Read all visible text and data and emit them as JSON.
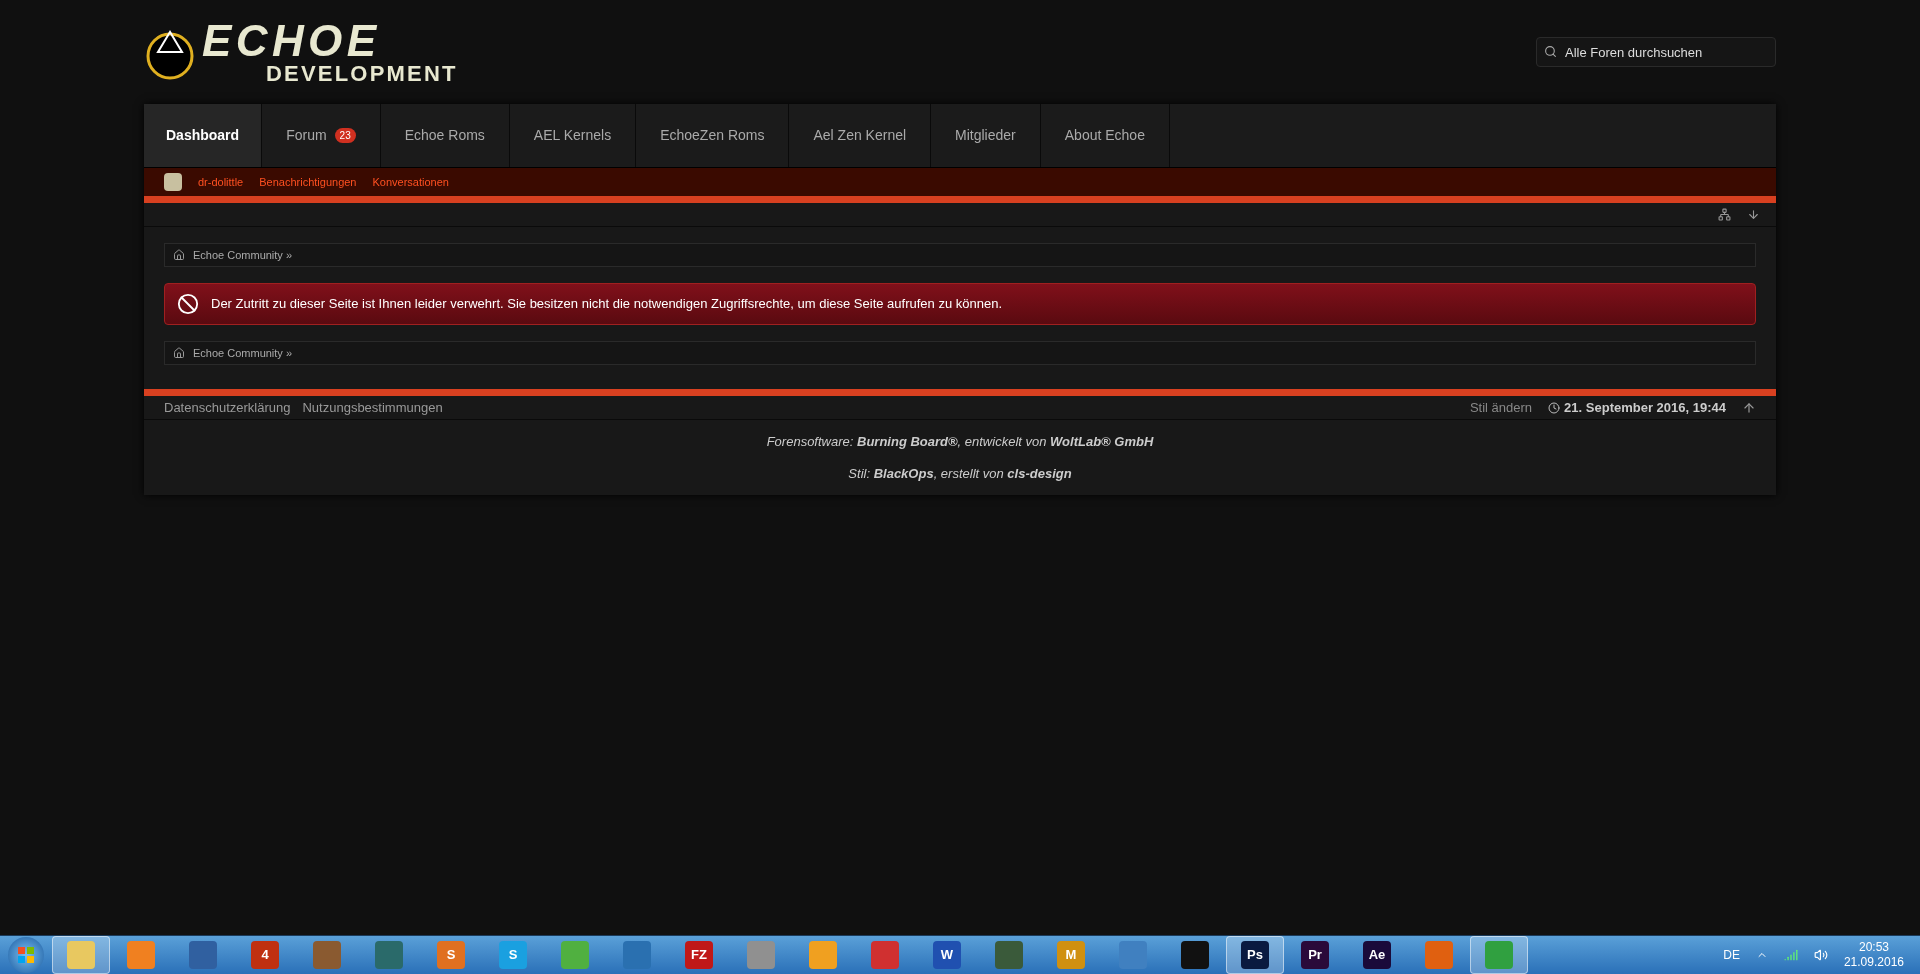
{
  "logo": {
    "title": "ECHOE",
    "subtitle": "DEVELOPMENT"
  },
  "search": {
    "placeholder": "Alle Foren durchsuchen"
  },
  "nav": [
    {
      "label": "Dashboard",
      "selected": true
    },
    {
      "label": "Forum",
      "badge": "23",
      "selected": false
    },
    {
      "label": "Echoe Roms",
      "selected": false
    },
    {
      "label": "AEL Kernels",
      "selected": false
    },
    {
      "label": "EchoeZen Roms",
      "selected": false
    },
    {
      "label": "Ael Zen Kernel",
      "selected": false
    },
    {
      "label": "Mitglieder",
      "selected": false
    },
    {
      "label": "About Echoe",
      "selected": false
    }
  ],
  "user_bar": [
    "dr-dolittle",
    "Benachrichtigungen",
    "Konversationen"
  ],
  "breadcrumb_top": "Echoe Community »",
  "error": "Der Zutritt zu dieser Seite ist Ihnen leider verwehrt. Sie besitzen nicht die notwendigen Zugriffsrechte, um diese Seite aufrufen zu können.",
  "breadcrumb_bottom": "Echoe Community »",
  "footer": {
    "links": [
      "Datenschutzerklärung",
      "Nutzungsbestimmungen"
    ],
    "style_link": "Stil ändern",
    "timestamp": "21. September 2016, 19:44",
    "credits": [
      "Forensoftware: **Burning Board®**, entwickelt von **WoltLab® GmbH**",
      "Stil: **BlackOps**, erstellt von **cls-design**"
    ]
  },
  "taskbar": {
    "items": [
      {
        "color": "#e8c860",
        "selected": true
      },
      {
        "color": "#f08020",
        "selected": false
      },
      {
        "color": "#3060a0",
        "selected": false
      },
      {
        "color": "#c03010",
        "label": "4",
        "selected": false
      },
      {
        "color": "#8a5a30",
        "selected": false
      },
      {
        "color": "#2a6a6a",
        "selected": false
      },
      {
        "color": "#e07020",
        "label": "S",
        "selected": false
      },
      {
        "color": "#1aa0e0",
        "label": "S",
        "selected": false
      },
      {
        "color": "#50b040",
        "selected": false
      },
      {
        "color": "#2a70b0",
        "selected": false
      },
      {
        "color": "#c01818",
        "label": "FZ",
        "selected": false
      },
      {
        "color": "#909090",
        "selected": false
      },
      {
        "color": "#f0a020",
        "selected": false
      },
      {
        "color": "#d03030",
        "selected": false
      },
      {
        "color": "#2050b0",
        "label": "W",
        "selected": false
      },
      {
        "color": "#3a5a3a",
        "selected": false
      },
      {
        "color": "#d09010",
        "label": "M",
        "selected": false
      },
      {
        "color": "#4080c0",
        "selected": false
      },
      {
        "color": "#111111",
        "selected": false
      },
      {
        "color": "#0a1a40",
        "label": "Ps",
        "selected": true
      },
      {
        "color": "#2a0a3a",
        "label": "Pr",
        "selected": false
      },
      {
        "color": "#1a0a3a",
        "label": "Ae",
        "selected": false
      },
      {
        "color": "#e06010",
        "selected": false
      },
      {
        "color": "#30a040",
        "selected": true
      }
    ],
    "language": "DE",
    "time": "20:53",
    "date": "21.09.2016"
  }
}
